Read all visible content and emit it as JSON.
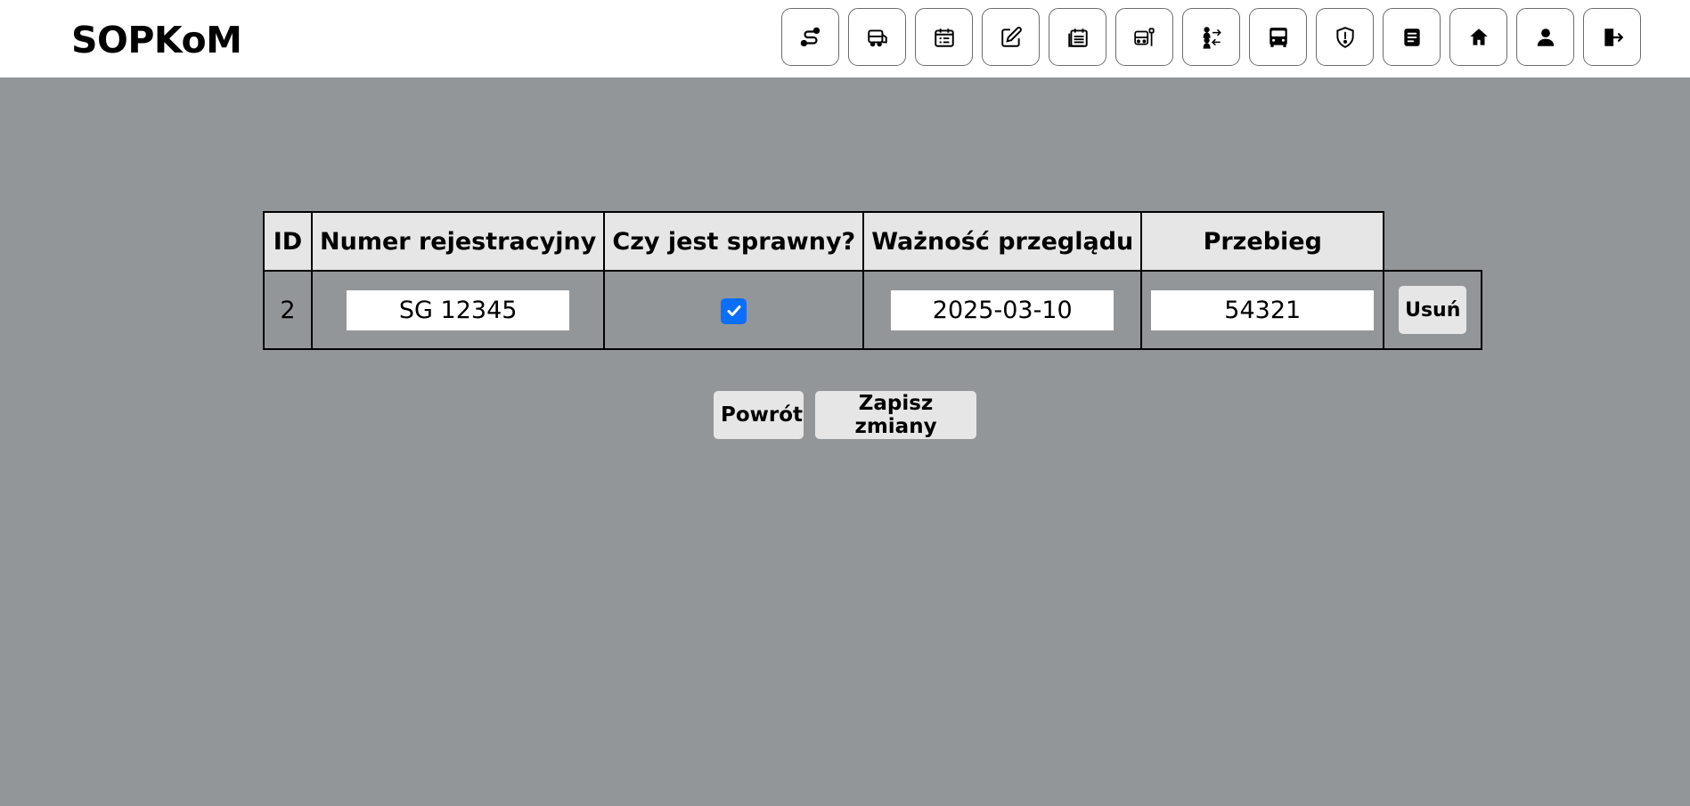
{
  "app": {
    "brand": "SOPKoM"
  },
  "nav": {
    "icons": [
      "route-icon",
      "bus-service-icon",
      "calendar-list-icon",
      "edit-icon",
      "schedule-icon",
      "bus-stop-icon",
      "people-exchange-icon",
      "bus-icon",
      "shield-alert-icon",
      "document-icon",
      "home-icon",
      "user-icon",
      "logout-icon"
    ]
  },
  "table": {
    "headers": {
      "id": "ID",
      "registration": "Numer rejestracyjny",
      "operational": "Czy jest sprawny?",
      "inspection": "Ważność przeglądu",
      "mileage": "Przebieg"
    },
    "row": {
      "id": "2",
      "registration": "SG 12345",
      "operational": true,
      "inspection": "2025-03-10",
      "mileage": "54321",
      "delete_label": "Usuń"
    }
  },
  "actions": {
    "back_label": "Powrót",
    "save_label": "Zapisz zmiany"
  },
  "colors": {
    "background": "#939699",
    "navbar": "#ffffff",
    "header_cell": "#e6e6e6",
    "checkbox": "#0b6efd",
    "button": "#e6e6e6"
  }
}
